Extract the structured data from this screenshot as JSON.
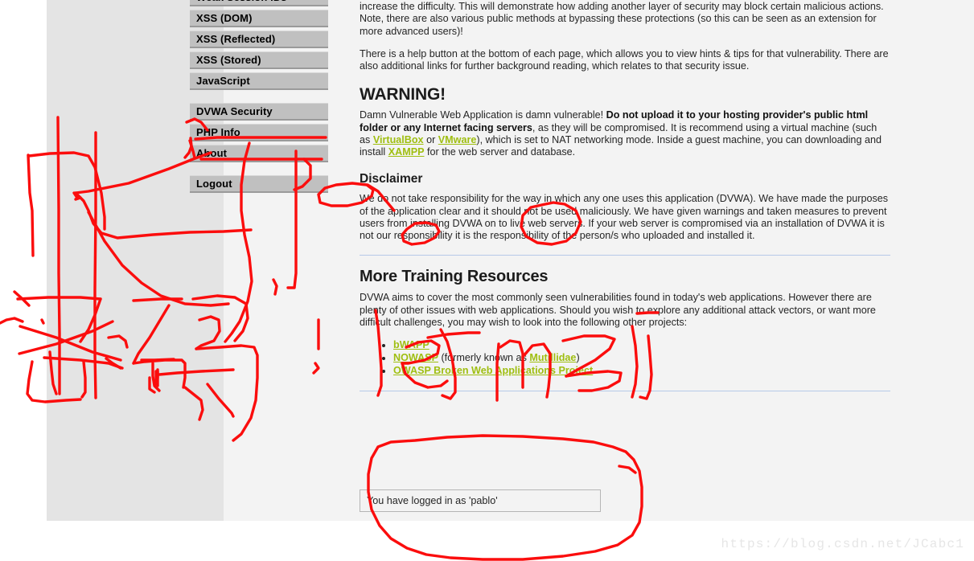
{
  "app": {
    "name": "DVWA",
    "page_title": "About"
  },
  "colors": {
    "page_background": "#ffffff",
    "content_background": "#f3f3f3",
    "sidebar_background": "#e4e4e4",
    "nav_button": "#c0c0c0",
    "link": "#9fbe10",
    "rule": "#b6c9e8",
    "annotation": "#fb0d0d",
    "watermark": "#e6e6e6"
  },
  "sidebar": {
    "groups": [
      {
        "items": [
          {
            "label": "Weak Session IDs",
            "clipped": true
          },
          {
            "label": "XSS (DOM)"
          },
          {
            "label": "XSS (Reflected)"
          },
          {
            "label": "XSS (Stored)"
          },
          {
            "label": "JavaScript"
          }
        ]
      },
      {
        "items": [
          {
            "label": "DVWA Security"
          },
          {
            "label": "PHP Info"
          },
          {
            "label": "About"
          }
        ]
      },
      {
        "items": [
          {
            "label": "Logout"
          }
        ]
      }
    ]
  },
  "content": {
    "intro_paragraph_1": "DVWA also includes a Web Application Firewall (WAF), PHPIDS, which can be enabled at any stage to further increase the difficulty. This will demonstrate how adding another layer of security may block certain malicious actions. Note, there are also various public methods at bypassing these protections (so this can be seen as an extension for more advanced users)!",
    "intro_paragraph_2": "There is a help button at the bottom of each page, which allows you to view hints & tips for that vulnerability. There are also additional links for further background reading, which relates to that security issue.",
    "warning": {
      "heading": "WARNING!",
      "text_1": "Damn Vulnerable Web Application is damn vulnerable! ",
      "bold_1": "Do not upload it to your hosting provider's public html folder or any Internet facing servers",
      "text_2": ", as they will be compromised. It is recommend using a virtual machine (such as ",
      "link_virtualbox": "VirtualBox",
      "text_3": " or ",
      "link_vmware": "VMware",
      "text_4": "), which is set to NAT networking mode. Inside a guest machine, you can downloading and install ",
      "link_xampp": "XAMPP",
      "text_5": " for the web server and database."
    },
    "disclaimer": {
      "heading": "Disclaimer",
      "text": "We do not take responsibility for the way in which any one uses this application (DVWA). We have made the purposes of the application clear and it should not be used maliciously. We have given warnings and taken measures to prevent users from installing DVWA on to live web servers. If your web server is compromised via an installation of DVWA it is not our responsibility it is the responsibility of the person/s who uploaded and installed it."
    },
    "more_training": {
      "heading": "More Training Resources",
      "text": "DVWA aims to cover the most commonly seen vulnerabilities found in today's web applications. However there are plenty of other issues with web applications. Should you wish to explore any additional attack vectors, or want more difficult challenges, you may wish to look into the following other projects:",
      "items": [
        {
          "link": "bWAPP",
          "suffix": ""
        },
        {
          "link": "NOWASP",
          "suffix": " (formerly known as ",
          "link2": "Mutillidae",
          "suffix2": ")"
        },
        {
          "link": "OWASP Broken Web Applications Project",
          "suffix": ""
        }
      ]
    }
  },
  "system_info": {
    "message": "You have logged in as 'pablo'"
  },
  "watermark": {
    "text": "https://blog.csdn.net/JCabc1"
  },
  "annotations": {
    "description": "Red hand-drawn marker strokes: Chinese characters at left, handwriting over the More Training Resources section, a circle around the Logout button, arrows pointing to PHP Info and About, and a large oval around the login status box.",
    "color": "#fb0d0d"
  }
}
